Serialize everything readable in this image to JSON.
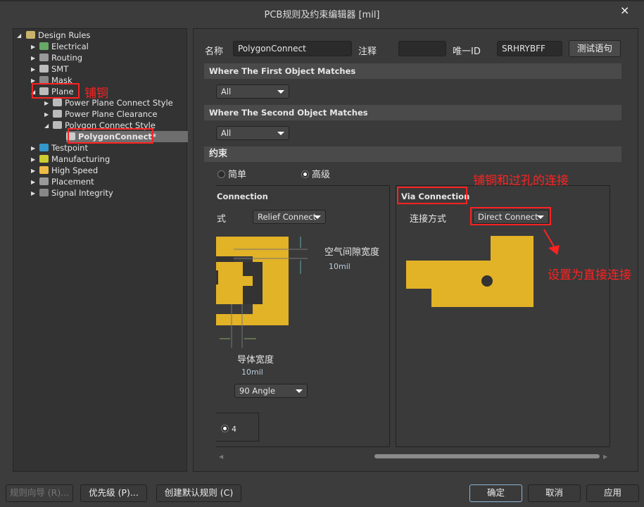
{
  "window": {
    "title": "PCB规则及约束编辑器 [mil]",
    "close": "×"
  },
  "tree": {
    "root": "Design Rules",
    "items": [
      {
        "label": "Electrical",
        "icon": "electrical-icon"
      },
      {
        "label": "Routing",
        "icon": "routing-icon"
      },
      {
        "label": "SMT",
        "icon": "smt-icon"
      },
      {
        "label": "Mask",
        "icon": "mask-icon"
      },
      {
        "label": "Plane",
        "icon": "plane-icon",
        "expanded": true
      },
      {
        "label": "Power Plane Connect Style",
        "icon": "plane-icon"
      },
      {
        "label": "Power Plane Clearance",
        "icon": "plane-icon"
      },
      {
        "label": "Polygon Connect Style",
        "icon": "plane-icon",
        "expanded": true
      },
      {
        "label": "PolygonConnect*",
        "icon": "rule-icon",
        "selected": true
      },
      {
        "label": "Testpoint",
        "icon": "testpoint-icon"
      },
      {
        "label": "Manufacturing",
        "icon": "manufacturing-icon"
      },
      {
        "label": "High Speed",
        "icon": "highspeed-icon"
      },
      {
        "label": "Placement",
        "icon": "placement-icon"
      },
      {
        "label": "Signal Integrity",
        "icon": "signal-icon"
      }
    ]
  },
  "form": {
    "name_label": "名称",
    "name_value": "PolygonConnect",
    "comment_label": "注释",
    "comment_value": "",
    "id_label": "唯一ID",
    "id_value": "SRHRYBFF",
    "test_button": "测试语句"
  },
  "first_match": {
    "header": "Where The First Object Matches",
    "value": "All"
  },
  "second_match": {
    "header": "Where The Second Object Matches",
    "value": "All"
  },
  "constraints": {
    "header": "约束",
    "simple": "简单",
    "advanced": "高级",
    "mode": "advanced",
    "connection": {
      "title": "Connection",
      "style_label": "式",
      "style_value": "Relief Connect",
      "air_gap_label": "空气间隙宽度",
      "air_gap_value": "10mil",
      "conductor_label": "导体宽度",
      "conductor_value": "10mil",
      "angle_value": "90 Angle",
      "conductors_radio": "4"
    },
    "via": {
      "title": "Via Connection",
      "style_label": "连接方式",
      "style_value": "Direct Connect"
    }
  },
  "annotations": {
    "plane": "铺铜",
    "via": "铺铜和过孔的连接",
    "direct": "设置为直接连接"
  },
  "buttons": {
    "wizard": "规则向导 (R)...",
    "priority": "优先级 (P)...",
    "create_default": "创建默认规则 (C)",
    "ok": "确定",
    "cancel": "取消",
    "apply": "应用"
  },
  "colors": {
    "copper": "#e2b227",
    "annotation": "#ff2222",
    "background": "#3c3c3c"
  }
}
